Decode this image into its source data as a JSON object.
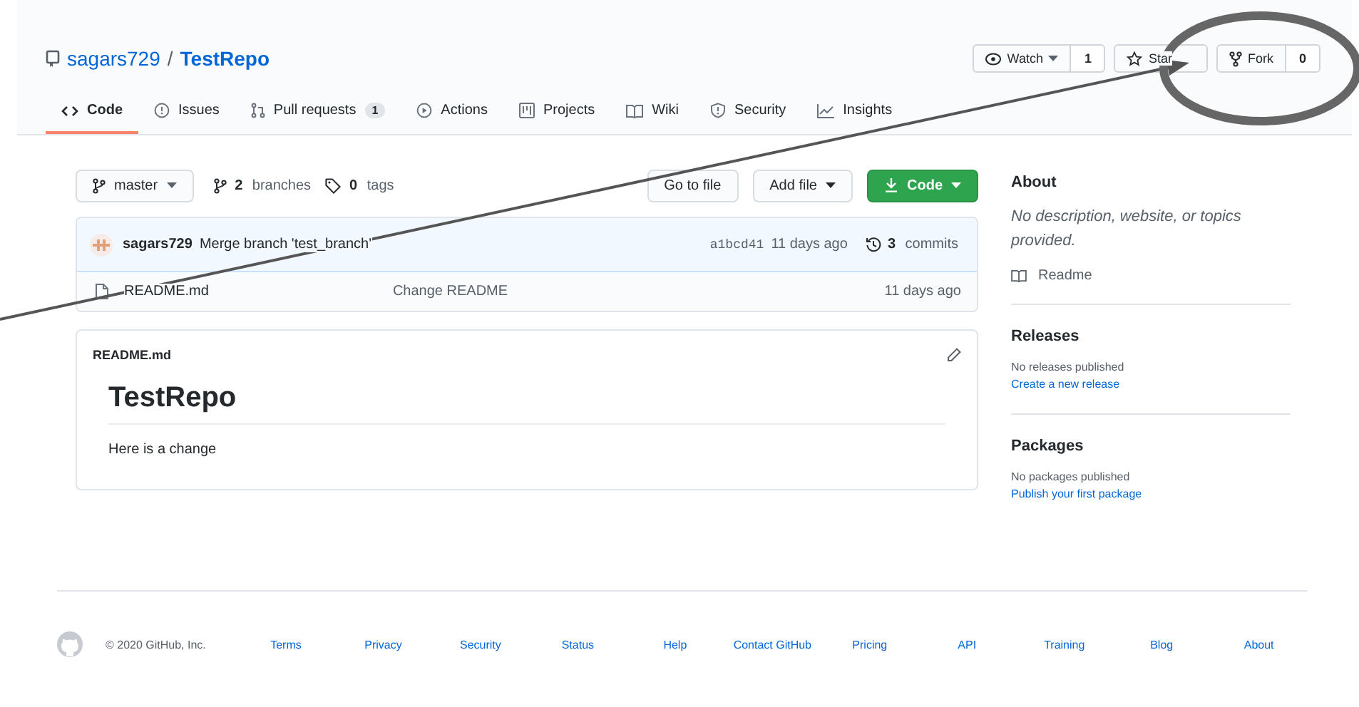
{
  "repo": {
    "owner": "sagars729",
    "separator": "/",
    "name": "TestRepo"
  },
  "header_actions": [
    {
      "kind": "watch",
      "label": "Watch",
      "dropdown": true,
      "count": "1"
    },
    {
      "kind": "star",
      "label": "Star"
    },
    {
      "kind": "fork",
      "label": "Fork",
      "count": "0"
    }
  ],
  "tabs": [
    {
      "kind": "code",
      "label": "Code",
      "selected": true
    },
    {
      "kind": "issues",
      "label": "Issues",
      "selected": false
    },
    {
      "kind": "pulls",
      "label": "Pull requests",
      "selected": false,
      "count": "1"
    },
    {
      "kind": "actions",
      "label": "Actions",
      "selected": false
    },
    {
      "kind": "projects",
      "label": "Projects",
      "selected": false
    },
    {
      "kind": "wiki",
      "label": "Wiki",
      "selected": false
    },
    {
      "kind": "security",
      "label": "Security",
      "selected": false
    },
    {
      "kind": "insights",
      "label": "Insights",
      "selected": false
    }
  ],
  "branch_bar": {
    "branch": "master",
    "branches_count": "2",
    "branches_label": "branches",
    "tags_count": "0",
    "tags_label": "tags",
    "go_to_file": "Go to file",
    "add_file": "Add file",
    "code": "Code"
  },
  "latest_commit": {
    "author": "sagars729",
    "message": "Merge branch 'test_branch'",
    "sha": "a1bcd41",
    "time": "11 days ago",
    "commits_count": "3",
    "commits_label": "commits"
  },
  "files": [
    {
      "name": "README.md",
      "message": "Change README",
      "time": "11 days ago"
    }
  ],
  "readme": {
    "filename": "README.md",
    "heading": "TestRepo",
    "body": "Here is a change"
  },
  "about": {
    "title": "About",
    "description": "No description, website, or topics provided.",
    "readme_link": "Readme"
  },
  "releases": {
    "title": "Releases",
    "text": "No releases published",
    "link": "Create a new release"
  },
  "packages": {
    "title": "Packages",
    "text": "No packages published",
    "link": "Publish your first package"
  },
  "footer": {
    "copyright": "© 2020 GitHub, Inc.",
    "links": [
      "Terms",
      "Privacy",
      "Security",
      "Status",
      "Help",
      "Contact GitHub",
      "Pricing",
      "API",
      "Training",
      "Blog",
      "About"
    ]
  },
  "annotations": [
    {
      "kind": "arrow"
    },
    {
      "kind": "ellipse"
    }
  ]
}
